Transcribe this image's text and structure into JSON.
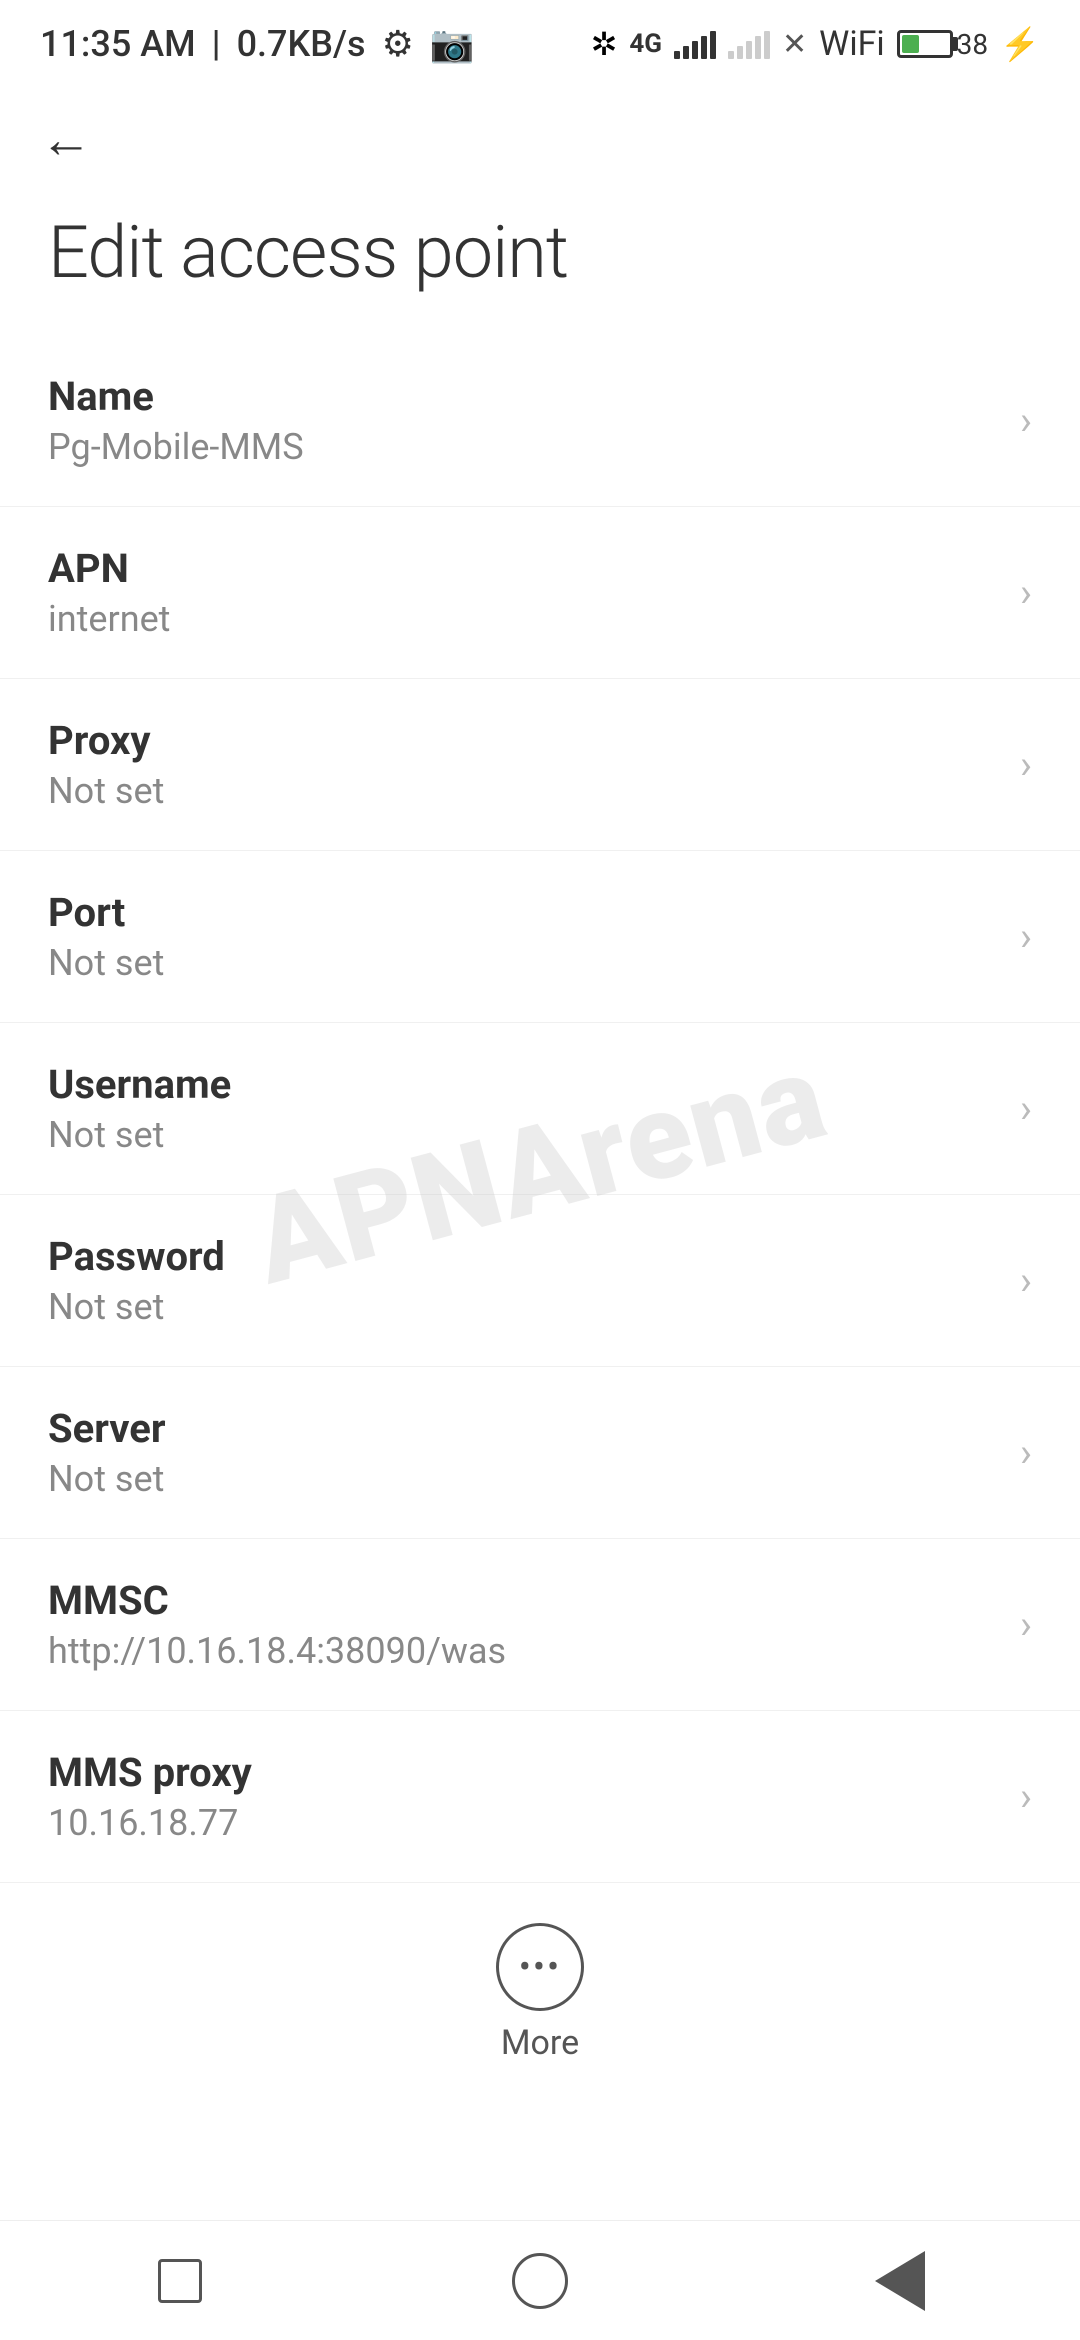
{
  "statusBar": {
    "time": "11:35 AM",
    "speed": "0.7KB/s",
    "battery": "38"
  },
  "header": {
    "backLabel": "←",
    "title": "Edit access point"
  },
  "settings": {
    "items": [
      {
        "label": "Name",
        "value": "Pg-Mobile-MMS"
      },
      {
        "label": "APN",
        "value": "internet"
      },
      {
        "label": "Proxy",
        "value": "Not set"
      },
      {
        "label": "Port",
        "value": "Not set"
      },
      {
        "label": "Username",
        "value": "Not set"
      },
      {
        "label": "Password",
        "value": "Not set"
      },
      {
        "label": "Server",
        "value": "Not set"
      },
      {
        "label": "MMSC",
        "value": "http://10.16.18.4:38090/was"
      },
      {
        "label": "MMS proxy",
        "value": "10.16.18.77"
      }
    ]
  },
  "more": {
    "label": "More"
  },
  "watermark": "APNArena",
  "navbar": {
    "squareLabel": "recent",
    "homeLabel": "home",
    "backLabel": "back"
  }
}
